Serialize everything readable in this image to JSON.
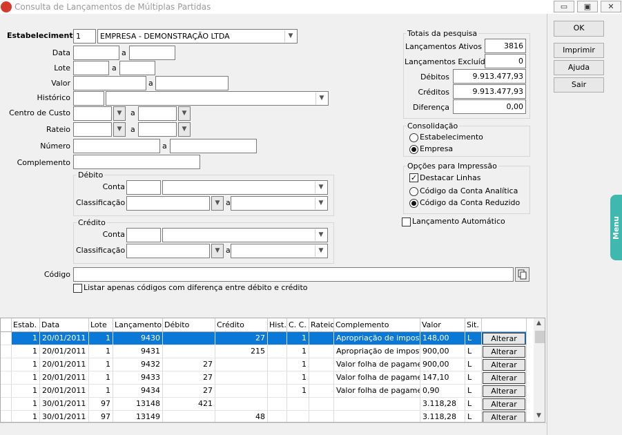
{
  "window": {
    "title": "Consulta de Lançamentos de Múltiplas Partidas",
    "minimize": "▭",
    "maximize": "▣",
    "close": "✕"
  },
  "filters": {
    "estabelecimento_label": "Estabelecimento",
    "estabelecimento_code": "1",
    "estabelecimento_name": "EMPRESA - DEMONSTRAÇÃO LTDA",
    "data_label": "Data",
    "lote_label": "Lote",
    "valor_label": "Valor",
    "historico_label": "Histórico",
    "centro_custo_label": "Centro de Custo",
    "rateio_label": "Rateio",
    "numero_label": "Número",
    "complemento_label": "Complemento",
    "range_sep": "a",
    "debito_title": "Débito",
    "credito_title": "Crédito",
    "conta_label": "Conta",
    "classificacao_label": "Classificação",
    "codigo_label": "Código",
    "listar_label": "Listar apenas códigos com diferença entre débito e crédito"
  },
  "totais": {
    "title": "Totais da pesquisa",
    "ativos_label": "Lançamentos Ativos",
    "ativos_value": "3816",
    "excluidos_label": "Lançamentos Excluídos",
    "excluidos_value": "0",
    "debitos_label": "Débitos",
    "debitos_value": "9.913.477,93",
    "creditos_label": "Créditos",
    "creditos_value": "9.913.477,93",
    "diferenca_label": "Diferença",
    "diferenca_value": "0,00"
  },
  "consolidacao": {
    "title": "Consolidação",
    "opt1": "Estabelecimento",
    "opt2": "Empresa",
    "selected": "Empresa"
  },
  "impressao": {
    "title": "Opções para Impressão",
    "destacar": "Destacar Linhas",
    "analitica": "Código da Conta Analítica",
    "reduzido": "Código da Conta Reduzido",
    "selected": "Código da Conta Reduzido"
  },
  "lancamento_auto": "Lançamento Automático",
  "buttons": {
    "ok": "OK",
    "imprimir": "Imprimir",
    "ajuda": "Ajuda",
    "sair": "Sair"
  },
  "menu_tab": "Menu",
  "grid": {
    "headers": [
      "Estab.",
      "Data",
      "Lote",
      "Lançamento",
      "Débito",
      "Crédito",
      "Hist.",
      "C. C.",
      "Rateio",
      "Complemento",
      "Valor",
      "Sit."
    ],
    "action_label": "Alterar",
    "rows": [
      [
        "1",
        "20/01/2011",
        "1",
        "9430",
        "",
        "27",
        "",
        "1",
        "",
        "Apropriação de imposto",
        "148,00",
        "L"
      ],
      [
        "1",
        "20/01/2011",
        "1",
        "9431",
        "",
        "215",
        "",
        "1",
        "",
        "Apropriação de imposto",
        "900,00",
        "L"
      ],
      [
        "1",
        "20/01/2011",
        "1",
        "9432",
        "27",
        "",
        "",
        "1",
        "",
        "Valor folha de pagamento",
        "900,00",
        "L"
      ],
      [
        "1",
        "20/01/2011",
        "1",
        "9433",
        "27",
        "",
        "",
        "1",
        "",
        "Valor folha de pagamento",
        "147,10",
        "L"
      ],
      [
        "1",
        "20/01/2011",
        "1",
        "9434",
        "27",
        "",
        "",
        "1",
        "",
        "Valor folha de pagamento",
        "0,90",
        "L"
      ],
      [
        "1",
        "30/01/2011",
        "97",
        "13148",
        "421",
        "",
        "",
        "",
        "",
        "",
        "3.118,28",
        "L"
      ],
      [
        "1",
        "30/01/2011",
        "97",
        "13149",
        "",
        "48",
        "",
        "",
        "",
        "",
        "3.118,28",
        "L"
      ]
    ]
  }
}
